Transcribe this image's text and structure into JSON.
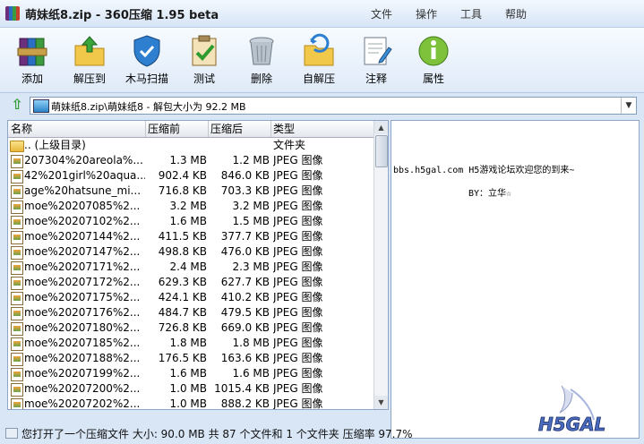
{
  "window": {
    "title": "萌妹纸8.zip - 360压缩 1.95 beta",
    "menu": [
      "文件",
      "操作",
      "工具",
      "帮助"
    ]
  },
  "toolbar": {
    "buttons": [
      {
        "label": "添加",
        "icon": "add-archive-icon"
      },
      {
        "label": "解压到",
        "icon": "extract-to-icon"
      },
      {
        "label": "木马扫描",
        "icon": "trojan-scan-shield-icon"
      },
      {
        "label": "测试",
        "icon": "test-clipboard-icon"
      },
      {
        "label": "删除",
        "icon": "delete-trash-icon"
      },
      {
        "label": "自解压",
        "icon": "self-extract-icon"
      },
      {
        "label": "注释",
        "icon": "comment-note-icon"
      },
      {
        "label": "属性",
        "icon": "properties-info-icon"
      }
    ]
  },
  "address": {
    "path": "萌妹纸8.zip\\萌妹纸8 - 解包大小为 92.2 MB"
  },
  "file_list": {
    "columns": [
      "名称",
      "压缩前",
      "压缩后",
      "类型"
    ],
    "parent": {
      "name": ".. (上级目录)",
      "type": "文件夹"
    },
    "rows": [
      {
        "name": "207304%20areola%...",
        "comp": "1.3 MB",
        "orig": "1.2 MB",
        "type": "JPEG 图像"
      },
      {
        "name": "42%201girl%20aqua...",
        "comp": "902.4 KB",
        "orig": "846.0 KB",
        "type": "JPEG 图像"
      },
      {
        "name": "age%20hatsune_mi...",
        "comp": "716.8 KB",
        "orig": "703.3 KB",
        "type": "JPEG 图像"
      },
      {
        "name": "moe%20207085%2...",
        "comp": "3.2 MB",
        "orig": "3.2 MB",
        "type": "JPEG 图像"
      },
      {
        "name": "moe%20207102%2...",
        "comp": "1.6 MB",
        "orig": "1.5 MB",
        "type": "JPEG 图像"
      },
      {
        "name": "moe%20207144%2...",
        "comp": "411.5 KB",
        "orig": "377.7 KB",
        "type": "JPEG 图像"
      },
      {
        "name": "moe%20207147%2...",
        "comp": "498.8 KB",
        "orig": "476.0 KB",
        "type": "JPEG 图像"
      },
      {
        "name": "moe%20207171%2...",
        "comp": "2.4 MB",
        "orig": "2.3 MB",
        "type": "JPEG 图像"
      },
      {
        "name": "moe%20207172%2...",
        "comp": "629.3 KB",
        "orig": "627.7 KB",
        "type": "JPEG 图像"
      },
      {
        "name": "moe%20207175%2...",
        "comp": "424.1 KB",
        "orig": "410.2 KB",
        "type": "JPEG 图像"
      },
      {
        "name": "moe%20207176%2...",
        "comp": "484.7 KB",
        "orig": "479.5 KB",
        "type": "JPEG 图像"
      },
      {
        "name": "moe%20207180%2...",
        "comp": "726.8 KB",
        "orig": "669.0 KB",
        "type": "JPEG 图像"
      },
      {
        "name": "moe%20207185%2...",
        "comp": "1.8 MB",
        "orig": "1.8 MB",
        "type": "JPEG 图像"
      },
      {
        "name": "moe%20207188%2...",
        "comp": "176.5 KB",
        "orig": "163.6 KB",
        "type": "JPEG 图像"
      },
      {
        "name": "moe%20207199%2...",
        "comp": "1.6 MB",
        "orig": "1.6 MB",
        "type": "JPEG 图像"
      },
      {
        "name": "moe%20207200%2...",
        "comp": "1.0 MB",
        "orig": "1015.4 KB",
        "type": "JPEG 图像"
      },
      {
        "name": "moe%20207202%2...",
        "comp": "1.0 MB",
        "orig": "888.2 KB",
        "type": "JPEG 图像"
      }
    ]
  },
  "preview": {
    "line1": "bbs.h5gal.com    H5游戏论坛欢迎您的到来~",
    "line2": "BY：立华☆",
    "logo_text": "H5GAL"
  },
  "status": {
    "text": "您打开了一个压缩文件 大小: 90.0 MB 共 87 个文件和 1 个文件夹 压缩率 97.7%"
  }
}
